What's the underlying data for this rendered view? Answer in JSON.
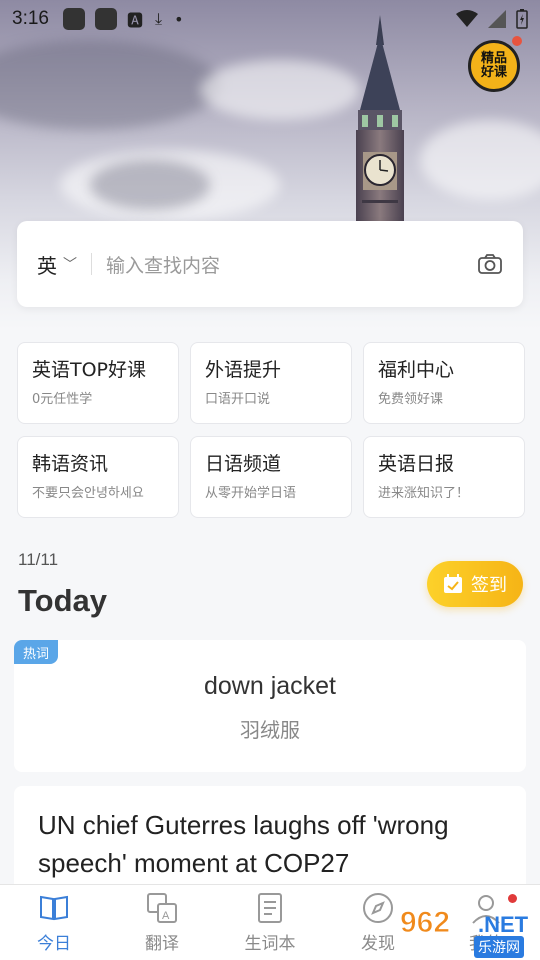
{
  "status_bar": {
    "time": "3:16"
  },
  "badge": {
    "line1": "精品",
    "line2": "好课"
  },
  "search": {
    "language": "英",
    "placeholder": "输入查找内容"
  },
  "grid": [
    {
      "title": "英语TOP好课",
      "subtitle": "0元任性学"
    },
    {
      "title": "外语提升",
      "subtitle": "口语开口说"
    },
    {
      "title": "福利中心",
      "subtitle": "免费领好课"
    },
    {
      "title": "韩语资讯",
      "subtitle": "不要只会안녕하세요"
    },
    {
      "title": "日语频道",
      "subtitle": "从零开始学日语"
    },
    {
      "title": "英语日报",
      "subtitle": "进来涨知识了！"
    }
  ],
  "today": {
    "date": "11/11",
    "heading": "Today",
    "checkin_label": "签到"
  },
  "word_card": {
    "tag": "热词",
    "english": "down jacket",
    "chinese": "羽绒服"
  },
  "news": {
    "title": "UN chief Guterres laughs off 'wrong speech' moment at COP27"
  },
  "tabs": [
    {
      "label": "今日",
      "icon": "book-icon",
      "active": true
    },
    {
      "label": "翻译",
      "icon": "translate-icon",
      "active": false
    },
    {
      "label": "生词本",
      "icon": "notebook-icon",
      "active": false
    },
    {
      "label": "发现",
      "icon": "compass-icon",
      "active": false
    },
    {
      "label": "我的",
      "icon": "profile-icon",
      "active": false
    }
  ],
  "watermark": {
    "brand": "962",
    "net": ".NET",
    "site": "乐游网"
  },
  "colors": {
    "accent": "#3b7fd8",
    "checkin": "#f6b416",
    "hot_tag": "#5aa6e8",
    "badge": "#f3b219"
  }
}
